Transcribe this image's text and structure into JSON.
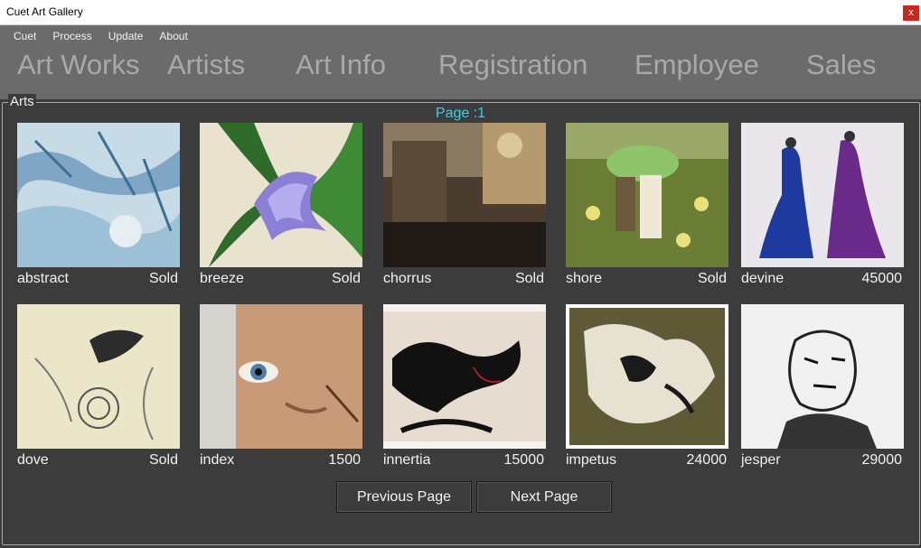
{
  "window": {
    "title": "Cuet Art Gallery",
    "close_label": "x"
  },
  "menu": [
    "Cuet",
    "Process",
    "Update",
    "About"
  ],
  "nav": [
    "Art Works",
    "Artists",
    "Art Info",
    "Registration",
    "Employee",
    "Sales"
  ],
  "panel": {
    "legend": "Arts",
    "page_label": "Page :1"
  },
  "artworks": [
    {
      "name": "abstract",
      "price": "Sold"
    },
    {
      "name": "breeze",
      "price": "Sold"
    },
    {
      "name": "chorrus",
      "price": "Sold"
    },
    {
      "name": "shore",
      "price": "Sold"
    },
    {
      "name": "devine",
      "price": "45000"
    },
    {
      "name": "dove",
      "price": "Sold"
    },
    {
      "name": "index",
      "price": "1500"
    },
    {
      "name": "innertia",
      "price": "15000"
    },
    {
      "name": "impetus",
      "price": "24000"
    },
    {
      "name": "jesper",
      "price": "29000"
    }
  ],
  "buttons": {
    "previous": "Previous Page",
    "next": "Next Page"
  }
}
